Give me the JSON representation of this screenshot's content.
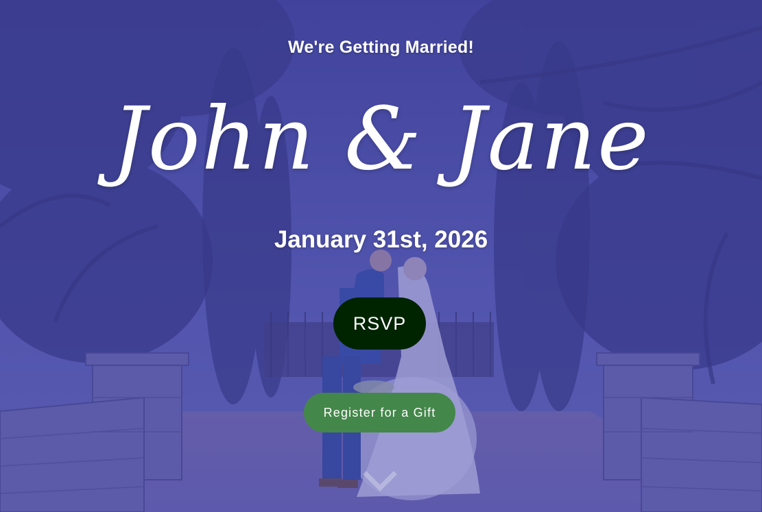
{
  "hero": {
    "kicker": "We're Getting Married!",
    "names": "John & Jane",
    "date": "January 31st, 2026",
    "rsvp_label": "RSVP",
    "gift_label": "Register for a Gift",
    "scroll_icon": "chevron-down-icon"
  },
  "colors": {
    "overlay": "#4648aa",
    "rsvp_button": "#002300",
    "gift_button": "#44874a",
    "text": "#ffffff"
  }
}
